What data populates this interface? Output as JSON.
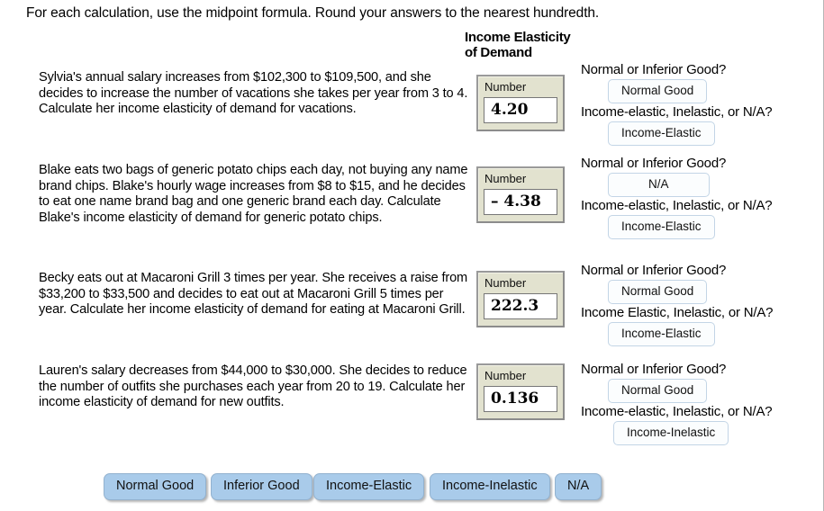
{
  "instruction": "For each calculation, use the midpoint formula. Round your answers to the nearest hundredth.",
  "column_header": {
    "line1": "Income Elasticity",
    "line2": "of Demand"
  },
  "number_field_label": "Number",
  "questions": [
    {
      "prompt": "Sylvia's annual salary increases from $102,300 to $109,500, and she decides to increase the number of vacations she takes per year from 3 to 4. Calculate her income elasticity of demand for vacations.",
      "number_label": "Number",
      "value": "4.20",
      "good_question": "Normal or Inferior Good?",
      "good_answer": "Normal Good",
      "elastic_question": "Income-elastic, Inelastic, or N/A?",
      "elastic_answer": "Income-Elastic"
    },
    {
      "prompt": "Blake eats two bags of generic potato chips each day, not buying any name brand chips. Blake's hourly wage increases from $8 to $15, and he decides to eat one name brand bag and one generic brand each day. Calculate Blake's income elasticity of demand for generic potato chips.",
      "number_label": "Number",
      "value": "– 4.38",
      "good_question": "Normal or Inferior Good?",
      "good_answer": "N/A",
      "elastic_question": "Income-elastic, Inelastic, or N/A?",
      "elastic_answer": "Income-Elastic"
    },
    {
      "prompt": "Becky eats out at Macaroni Grill 3 times per year. She receives a raise from $33,200 to $33,500 and decides to eat out at Macaroni Grill 5 times per year. Calculate her income elasticity of demand for eating at Macaroni Grill.",
      "number_label": "Number",
      "value": "222.3",
      "good_question": "Normal or Inferior Good?",
      "good_answer": "Normal Good",
      "elastic_question": "Income Elastic, Inelastic, or N/A?",
      "elastic_answer": "Income-Elastic"
    },
    {
      "prompt": "Lauren's salary decreases from $44,000 to $30,000. She decides to reduce the number of outfits she purchases each year from 20 to 19. Calculate her income elasticity of demand for new outfits.",
      "number_label": "Number",
      "value": "0.136",
      "good_question": "Normal or Inferior Good?",
      "good_answer": "Normal Good",
      "elastic_question": "Income-elastic, Inelastic, or N/A?",
      "elastic_answer": "Income-Inelastic"
    }
  ],
  "tray_tokens": [
    {
      "label": "Normal Good"
    },
    {
      "label": "Inferior Good"
    },
    {
      "label": "Income-Elastic"
    },
    {
      "label": "Income-Inelastic"
    },
    {
      "label": "N/A"
    }
  ],
  "colors": {
    "token_fill": "#a9cbea",
    "token_border": "#93b2cf",
    "numbox_fill": "#e2e2cf",
    "numbox_border": "#8c8c8c",
    "slot_border": "#c3d5e6",
    "page_background": "#ffffff"
  }
}
